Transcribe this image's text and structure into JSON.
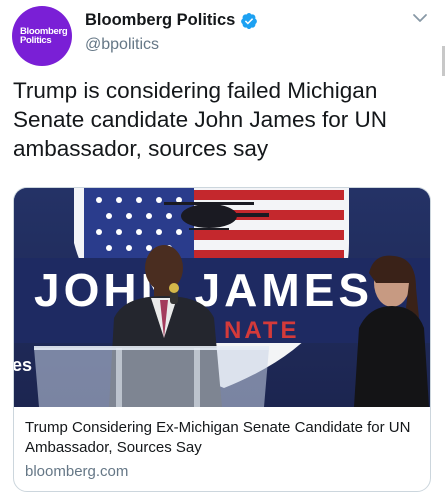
{
  "account": {
    "avatar_line1": "Bloomberg",
    "avatar_line2": "Politics",
    "display_name": "Bloomberg Politics",
    "handle": "@bpolitics",
    "verified": true
  },
  "tweet": {
    "text": "Trump is considering failed Michigan Senate candidate John James for UN ambassador, sources say"
  },
  "card": {
    "image_text_main": "JOHN JAMES",
    "image_text_sub": "NATE",
    "image_text_edge": "es",
    "title": "Trump Considering Ex-Michigan Senate Candidate for UN Ambassador, Sources Say",
    "domain": "bloomberg.com"
  },
  "colors": {
    "brand_purple": "#7a1fd6",
    "verified_blue": "#1da1f2",
    "text": "#14171a",
    "secondary": "#657786"
  },
  "icons": [
    "verified-badge-icon",
    "chevron-down-icon"
  ]
}
